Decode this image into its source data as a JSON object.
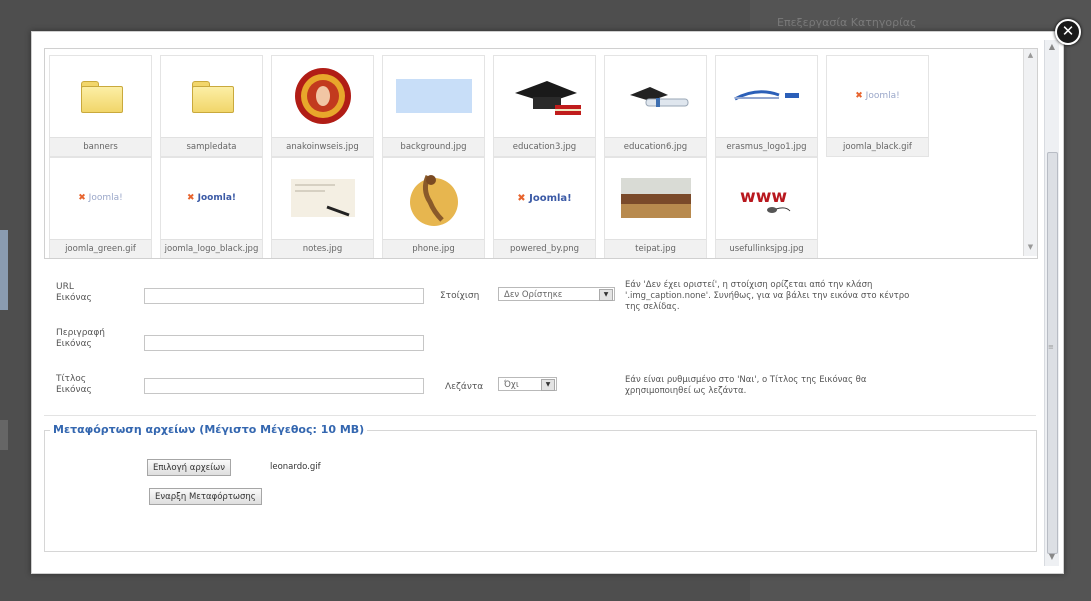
{
  "background": {
    "panel_title": "Επεξεργασία Κατηγορίας"
  },
  "modal": {
    "close_glyph": "✕",
    "files": [
      {
        "name": "banners",
        "icon": "folder-icon"
      },
      {
        "name": "sampledata",
        "icon": "folder-icon"
      },
      {
        "name": "anakoinwseis.jpg",
        "icon": "emblem-image"
      },
      {
        "name": "background.jpg",
        "icon": "lightblue-image"
      },
      {
        "name": "education3.jpg",
        "icon": "graduation-cap-image"
      },
      {
        "name": "education6.jpg",
        "icon": "diploma-image"
      },
      {
        "name": "erasmus_logo1.jpg",
        "icon": "erasmus-logo-image"
      },
      {
        "name": "joomla_black.gif",
        "icon": "joomla-logo-image"
      },
      {
        "name": "joomla_green.gif",
        "icon": "joomla-logo-image"
      },
      {
        "name": "joomla_logo_black.jpg",
        "icon": "joomla-logo-image"
      },
      {
        "name": "notes.jpg",
        "icon": "notes-image"
      },
      {
        "name": "phone.jpg",
        "icon": "phone-image"
      },
      {
        "name": "powered_by.png",
        "icon": "joomla-logo-image"
      },
      {
        "name": "teipat.jpg",
        "icon": "building-image"
      },
      {
        "name": "usefullinksjpg.jpg",
        "icon": "www-image"
      }
    ],
    "form": {
      "url_label_1": "URL",
      "url_label_2": "Εικόνας",
      "align_label": "Στοίχιση",
      "align_value": "Δεν Ορίστηκε",
      "align_hint_1": "Εάν 'Δεν έχει οριστεί', η στοίχιση ορίζεται από την κλάση",
      "align_hint_2": "'.img_caption.none'. Συνήθως, για να βάλει την εικόνα στο κέντρο",
      "align_hint_3": "της σελίδας.",
      "desc_label_1": "Περιγραφή",
      "desc_label_2": "Εικόνας",
      "title_label_1": "Τίτλος",
      "title_label_2": "Εικόνας",
      "caption_label": "Λεζάντα",
      "caption_value": "Όχι",
      "caption_hint_1": "Εάν είναι ρυθμισμένο στο 'Ναι', ο Τίτλος της Εικόνας θα",
      "caption_hint_2": "χρησιμοποιηθεί ως λεζάντα."
    },
    "upload": {
      "legend": "Μεταφόρτωση αρχείων (Μέγιστο Μέγεθος: 10 MB)",
      "choose_button": "Επιλογή αρχείων",
      "filename": "leonardo.gif",
      "start_button": "Εναρξη Μεταφόρτωσης"
    }
  }
}
